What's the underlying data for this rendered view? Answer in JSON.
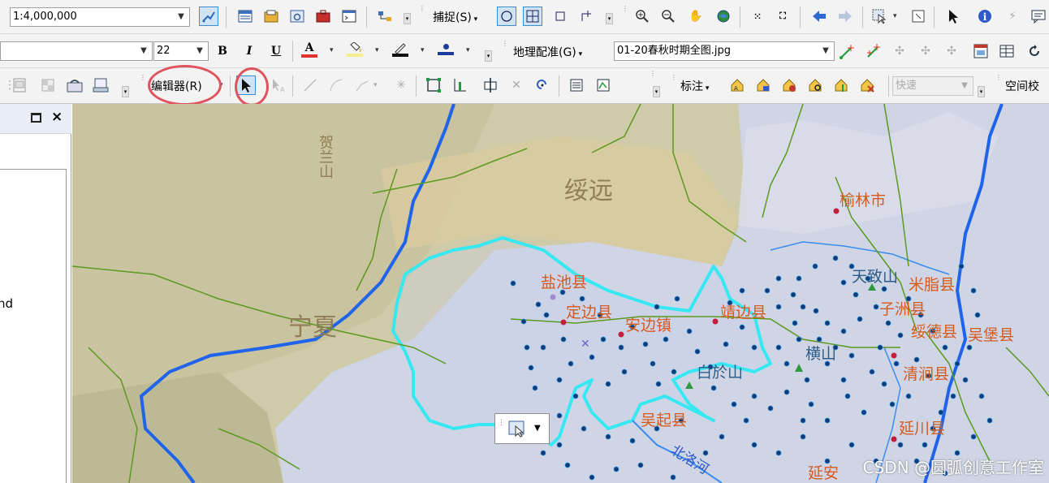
{
  "toolbar": {
    "scale_value": "1:4,000,000",
    "font_name_value": "",
    "font_size_value": "22",
    "bold_label": "B",
    "italic_label": "I",
    "underline_label": "U",
    "font_color_glyph": "A",
    "snapping_menu": "捕捉(S)",
    "georeferencing_menu": "地理配准(G)",
    "georef_layer_value": "01-20春秋时期全图.jpg",
    "editor_menu": "编辑器(R)",
    "labeling_menu": "标注",
    "label_quality_value": "快速",
    "spatial_adjust_menu": "空间校"
  },
  "left_panel": {
    "partial_text": "nd"
  },
  "map": {
    "labels": {
      "helan_mountain": "贺兰山",
      "suiyuan": "绥远",
      "ningxia": "宁夏",
      "yulin": "榆林市",
      "yanchi": "盐池县",
      "dingbian": "定边县",
      "anbian": "安边镇",
      "jingbian": "靖边县",
      "tianziShan": "天致山",
      "mizhi": "米脂县",
      "zizhou": "子洲县",
      "suide": "绥德县",
      "wubao": "吴堡县",
      "hengshan": "横山",
      "baiyu": "白於山",
      "qingjian": "清涧县",
      "wuqi": "吴起县",
      "yanchuan": "延川县",
      "beiluo": "北洛河",
      "yanan": "延安"
    },
    "colors": {
      "boundary": "#35e8f2",
      "river": "#1f64ea",
      "road": "#5a9a1e",
      "points": "#0d3a78",
      "overlay": "#cfd6ea"
    }
  },
  "watermark": "CSDN @圆弧创意工作室"
}
